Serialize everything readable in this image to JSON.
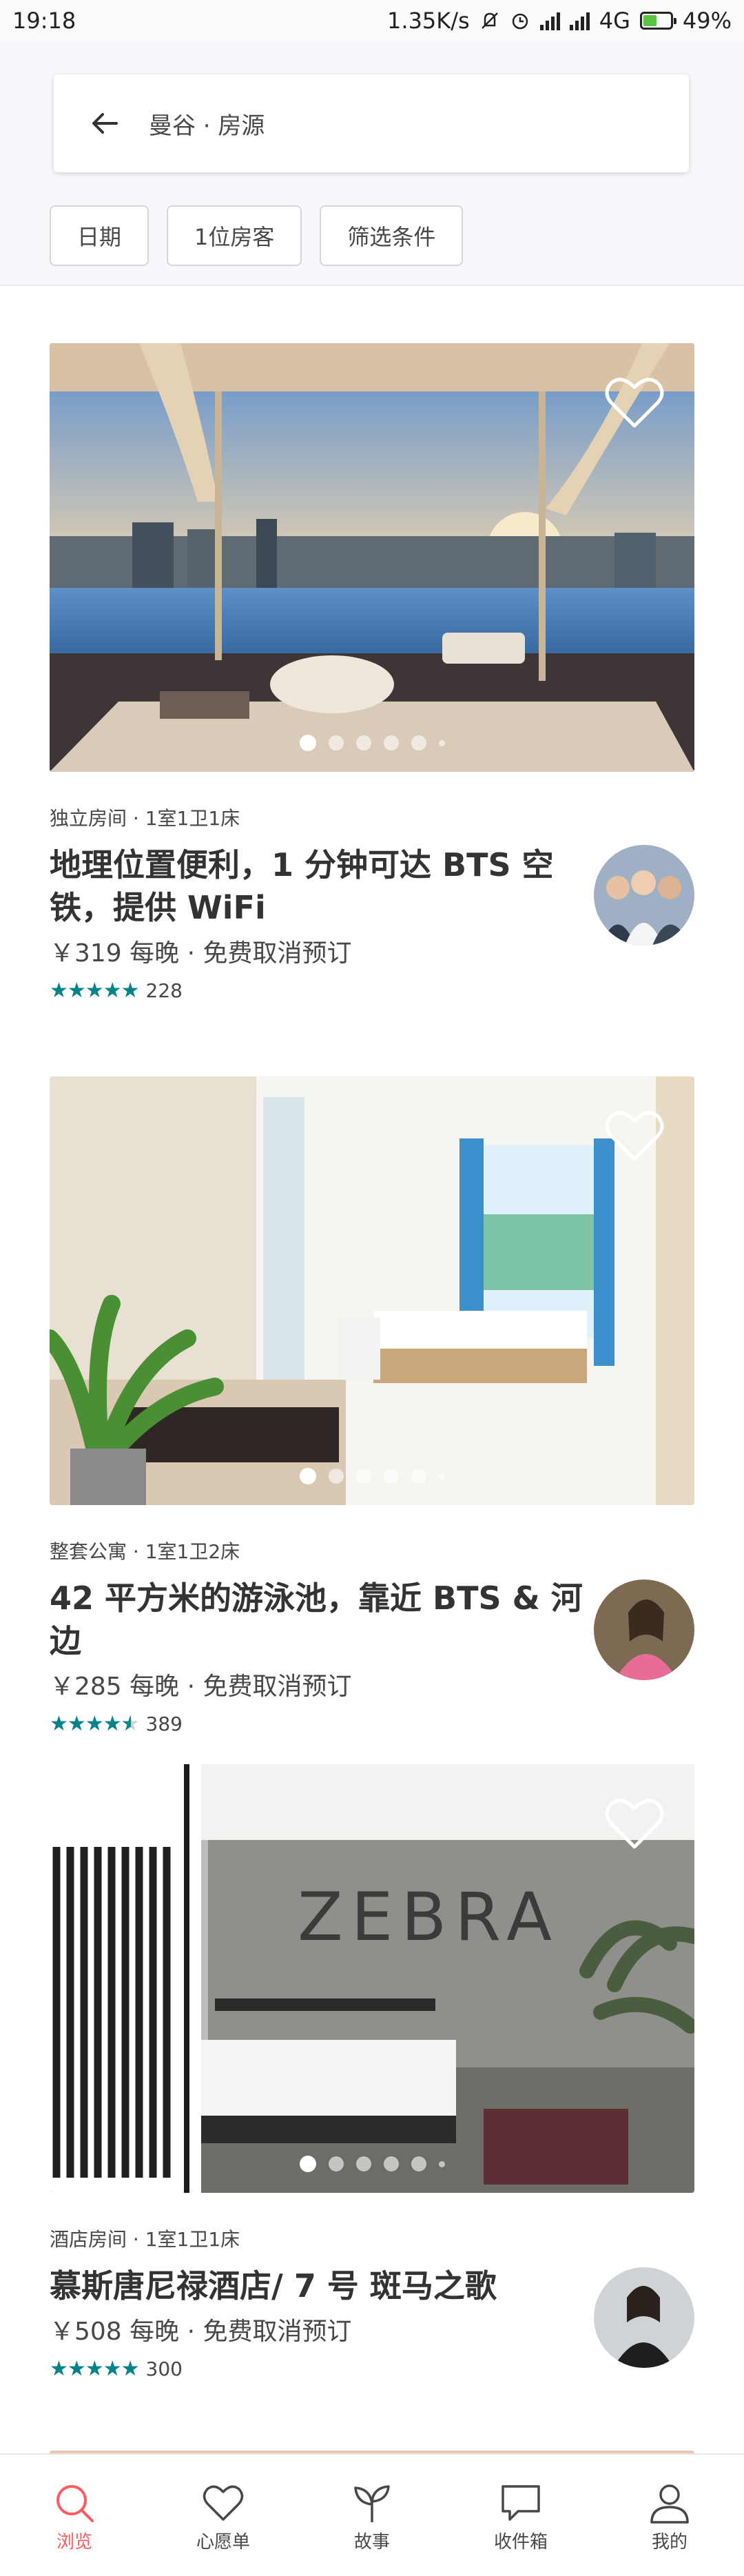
{
  "status_bar": {
    "time": "19:18",
    "network_speed": "1.35K/s",
    "network_type": "4G",
    "battery": "49%",
    "battery_level": 0.49
  },
  "search": {
    "back_icon": "arrow-left-icon",
    "query": "曼谷 · 房源"
  },
  "filters": [
    {
      "label": "日期"
    },
    {
      "label": "1位房客"
    },
    {
      "label": "筛选条件"
    }
  ],
  "listings": [
    {
      "meta": "独立房间 · 1室1卫1床",
      "title": "地理位置便利，1 分钟可达 BTS 空铁，提供 WiFi",
      "price": "￥319 每晚 · 免费取消预订",
      "rating": 5,
      "reviews": "228"
    },
    {
      "meta": "整套公寓 · 1室1卫2床",
      "title": "42 平方米的游泳池，靠近 BTS & 河边",
      "price": "￥285 每晚 · 免费取消预订",
      "rating": 4.5,
      "reviews": "389"
    },
    {
      "meta": "酒店房间 · 1室1卫1床",
      "title": "慕斯唐尼禄酒店/ 7 号 斑马之歌",
      "price": "￥508 每晚 · 免费取消预订",
      "rating": 5,
      "reviews": "300",
      "wall_sign": "ZEBRA"
    }
  ],
  "tabs": [
    {
      "label": "浏览",
      "icon": "search-icon",
      "active": true
    },
    {
      "label": "心愿单",
      "icon": "heart-icon",
      "active": false
    },
    {
      "label": "故事",
      "icon": "sprout-icon",
      "active": false
    },
    {
      "label": "收件箱",
      "icon": "chat-bubble-icon",
      "active": false
    },
    {
      "label": "我的",
      "icon": "profile-icon",
      "active": false
    }
  ],
  "colors": {
    "accent": "#ff5a5f",
    "star": "#008489",
    "text": "#484848"
  }
}
